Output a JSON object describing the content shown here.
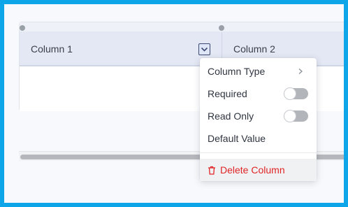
{
  "table": {
    "columns": [
      {
        "title": "Column 1"
      },
      {
        "title": "Column 2"
      }
    ]
  },
  "menu": {
    "column_type": "Column Type",
    "required": "Required",
    "read_only": "Read Only",
    "default_value": "Default Value",
    "delete_column": "Delete Column",
    "required_enabled": false,
    "read_only_enabled": false
  },
  "colors": {
    "accent_frame": "#0ea5e9",
    "danger": "#e02424"
  },
  "icons": {
    "column_toggle": "chevron-down-icon",
    "submenu": "chevron-right-icon",
    "delete": "trash-icon"
  }
}
